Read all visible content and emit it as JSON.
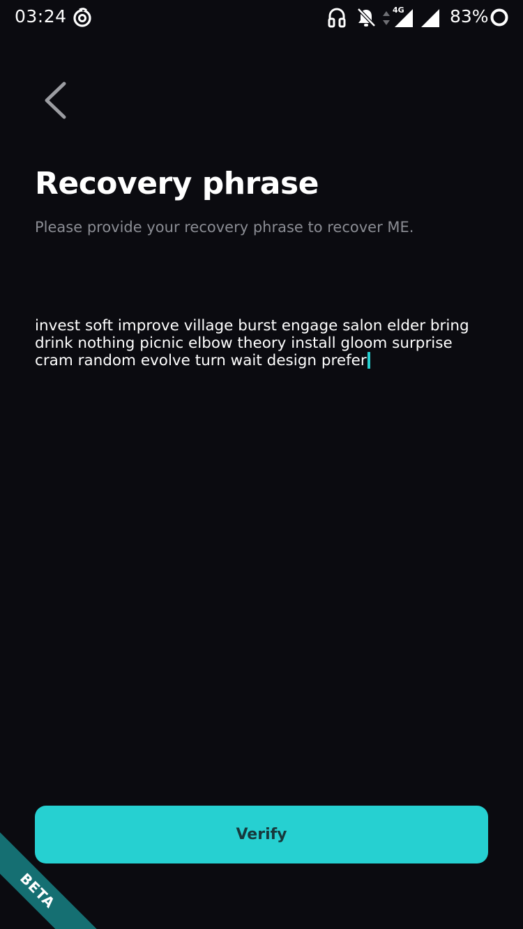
{
  "status_bar": {
    "time": "03:24",
    "network_type": "4G",
    "battery_text": "83%",
    "icons": [
      "app-notification-icon",
      "headphones-icon",
      "notifications-off-icon",
      "data-arrows-icon",
      "signal-icon",
      "signal-icon",
      "battery-ring-icon"
    ]
  },
  "header": {
    "back_icon": "chevron-left-icon"
  },
  "main": {
    "title": "Recovery phrase",
    "subtitle": "Please provide your recovery phrase to recover ME.",
    "phrase_value": "invest soft improve village burst engage salon elder bring\ndrink nothing picnic elbow theory install gloom surprise\ncram random evolve turn wait design prefer"
  },
  "footer": {
    "verify_label": "Verify",
    "beta_label": "BETA"
  },
  "colors": {
    "background": "#0b0b10",
    "accent": "#26d0d1",
    "button_text": "#17393c",
    "subtitle": "#8b8d94",
    "beta_ribbon": "#156f72"
  }
}
